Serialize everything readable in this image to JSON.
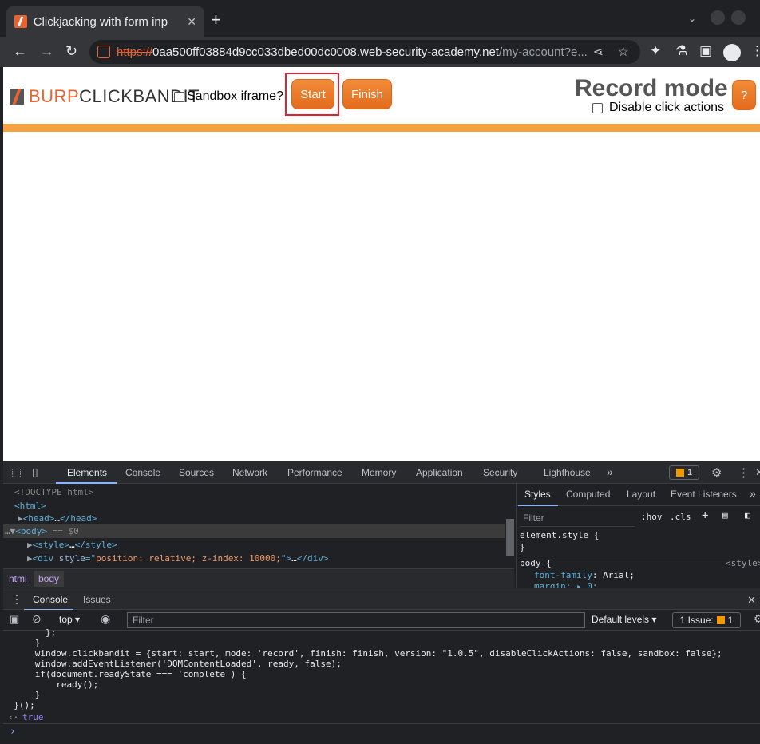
{
  "browser": {
    "tab_title": "Clickjacking with form inp",
    "tab_close": "✕",
    "new_tab": "+",
    "url_proto": "https://",
    "url_host": "0aa500ff03884d9cc033dbed00dc0008.web-security-academy.net",
    "url_path": "/my-account?e..."
  },
  "clickbandit": {
    "logo_burp": "BURP",
    "logo_rest": "CLICKBANDIT",
    "sandbox_label": "Sandbox iframe?",
    "start_label": "Start",
    "finish_label": "Finish",
    "mode_title": "Record mode",
    "disable_label": "Disable click actions",
    "help_label": "?",
    "accent_color": "#e8632f",
    "bar_color": "#f7a240"
  },
  "devtools": {
    "tabs": [
      "Elements",
      "Console",
      "Sources",
      "Network",
      "Performance",
      "Memory",
      "Application",
      "Security",
      "Lighthouse"
    ],
    "more": "»",
    "issue_count": "1",
    "elements": {
      "doctype": "<!DOCTYPE html>",
      "html": "<html>",
      "head_open": "<head>",
      "head_ellipsis": "…",
      "head_close": "</head>",
      "body_open": "<body>",
      "body_eq": " == $0",
      "style_open": "<style>",
      "style_ellipsis": "…",
      "style_close": "</style>",
      "div_open": "<div ",
      "div_attr": "style",
      "div_eq": "=\"",
      "div_val": "position: relative; z-index: 10000;",
      "div_end": "\">",
      "div_ellipsis": "…",
      "div_close": "</div>"
    },
    "styles": {
      "tabs": [
        "Styles",
        "Computed",
        "Layout",
        "Event Listeners"
      ],
      "filter_placeholder": "Filter",
      "hov": ":hov",
      "cls": ".cls",
      "element_style": "element.style {",
      "close_brace": "}",
      "body_selector": "body {",
      "source": "<style>",
      "prop1_name": "font-family",
      "prop1_val": ": Arial;",
      "prop2": "margin: ▸ 0;"
    },
    "breadcrumbs": [
      "html",
      "body"
    ],
    "drawer_tabs": [
      "Console",
      "Issues"
    ],
    "console": {
      "context": "top ▾",
      "filter_placeholder": "Filter",
      "levels": "Default levels ▾",
      "issue_pill": "1 Issue:",
      "issue_pill_count": "1",
      "lines": [
        "        };",
        "      }",
        "      window.clickbandit = {start: start, mode: 'record', finish: finish, version: \"1.0.5\", disableClickActions: false, sandbox: false};",
        "      window.addEventListener('DOMContentLoaded', ready, false);",
        "      if(document.readyState === 'complete') {",
        "          ready();",
        "      }",
        "  }();"
      ],
      "result_arrow": "‹·",
      "result": "true",
      "prompt": "›"
    }
  }
}
